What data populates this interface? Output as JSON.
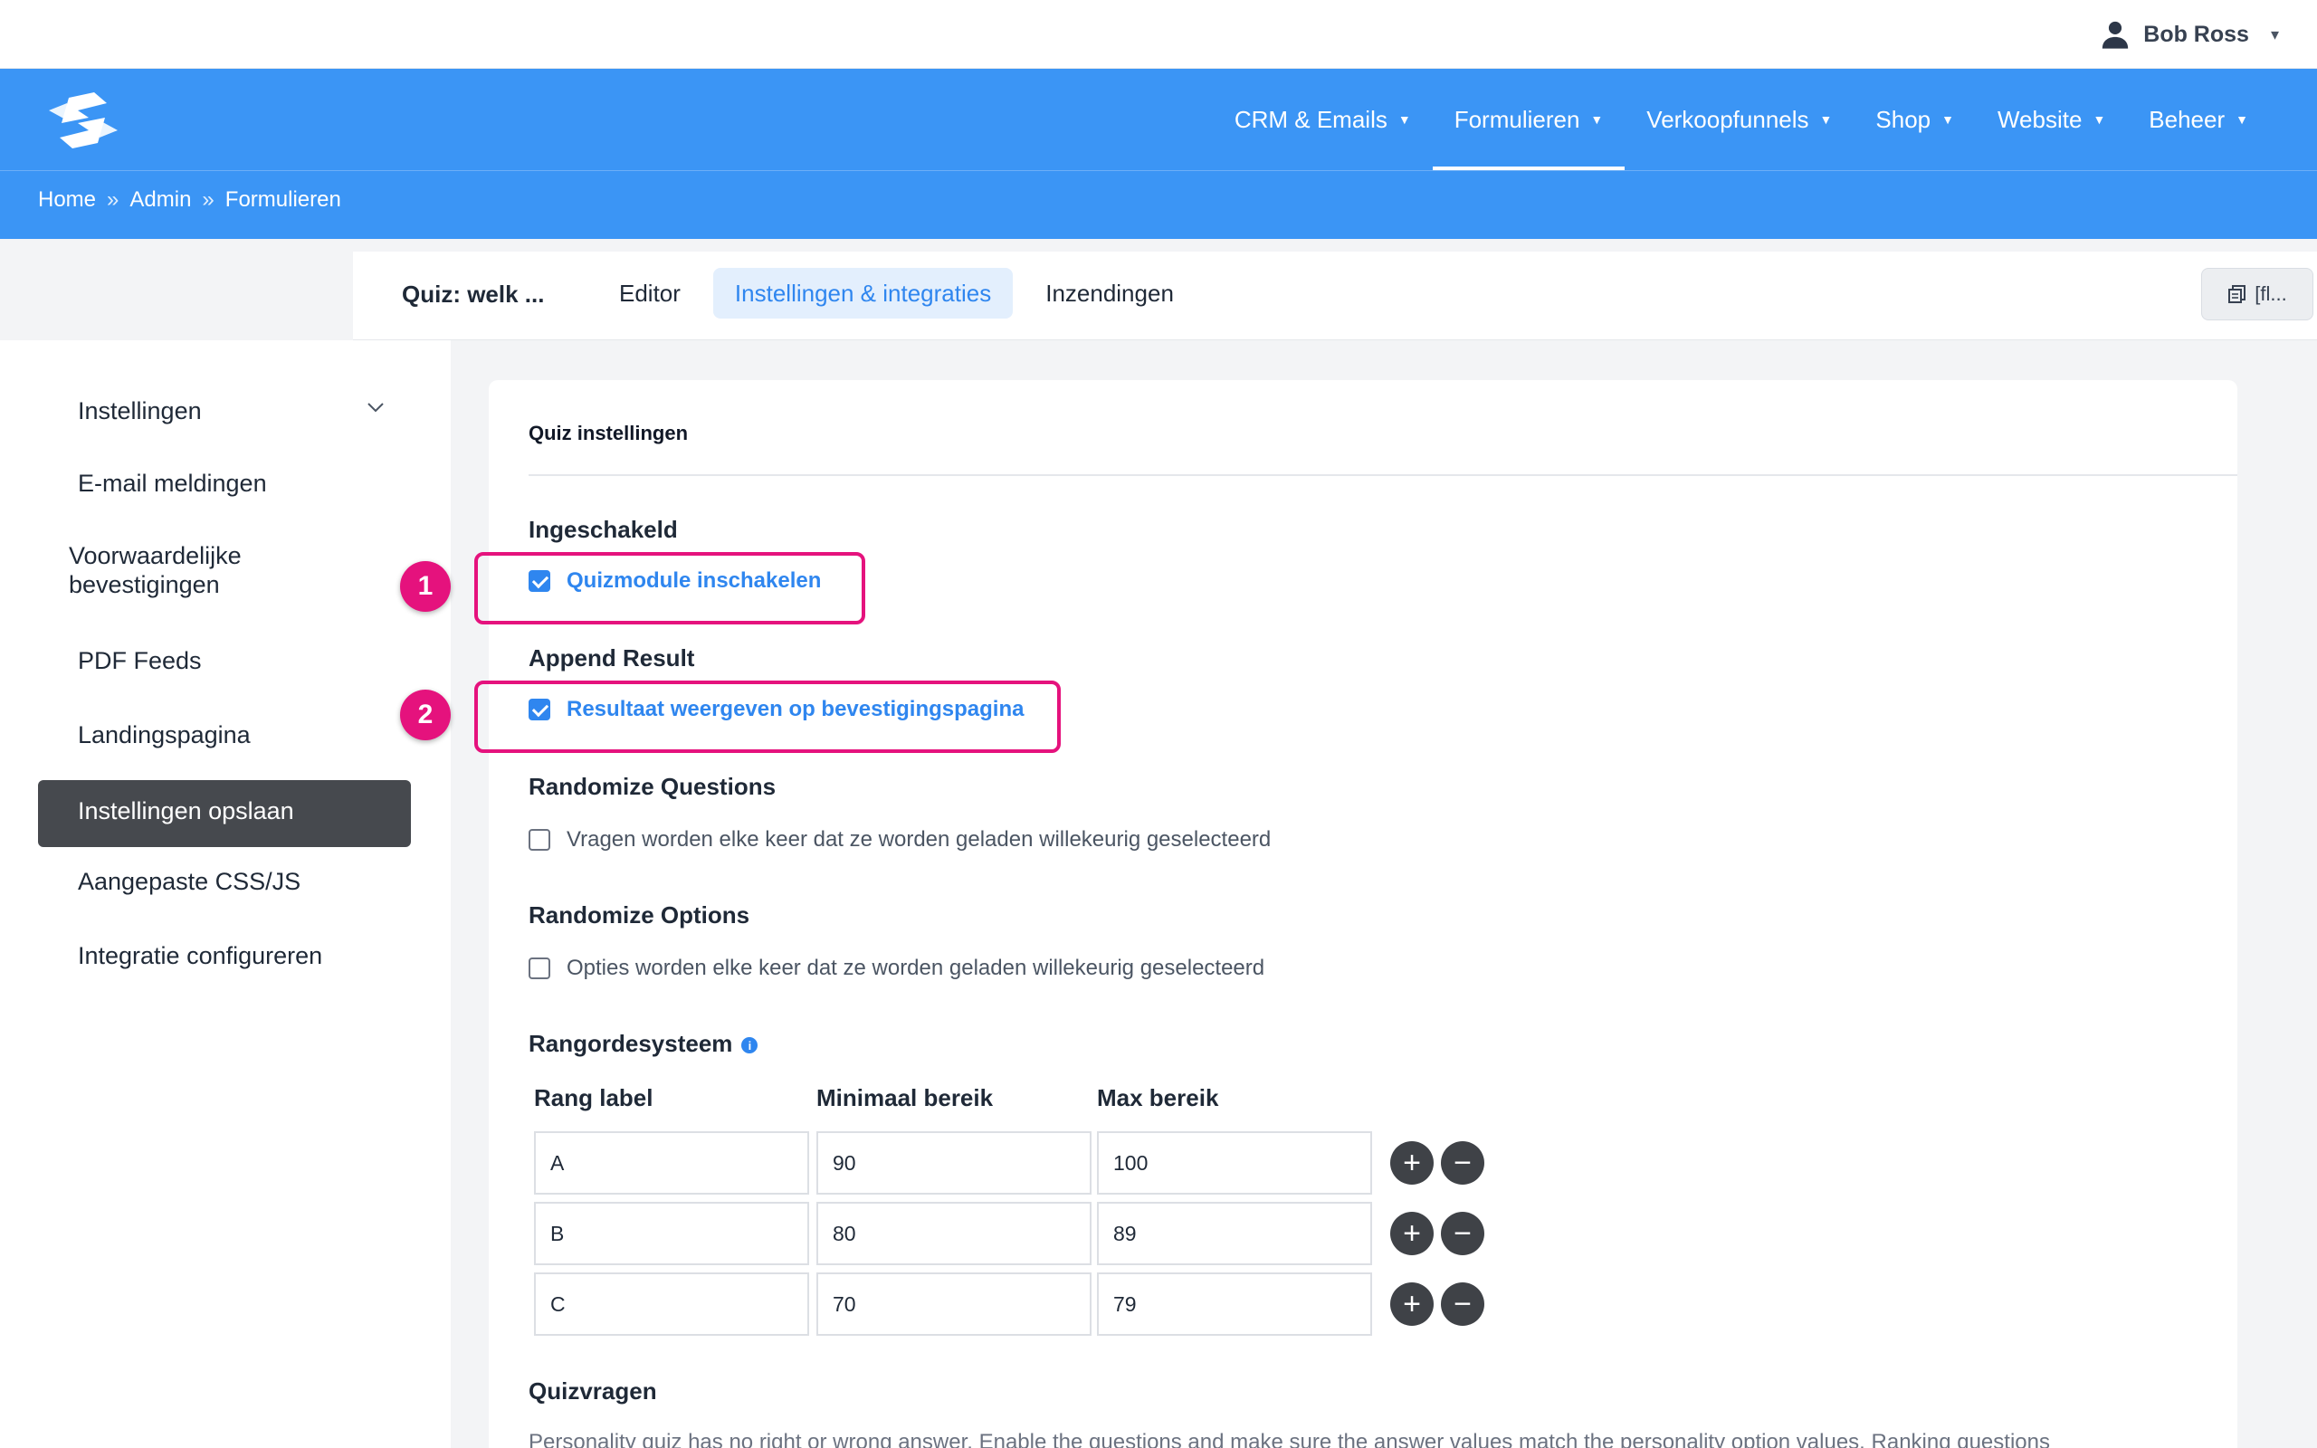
{
  "user": {
    "name": "Bob Ross",
    "caret": "▾"
  },
  "nav": {
    "items": [
      {
        "label": "CRM & Emails"
      },
      {
        "label": "Formulieren"
      },
      {
        "label": "Verkoopfunnels"
      },
      {
        "label": "Shop"
      },
      {
        "label": "Website"
      },
      {
        "label": "Beheer"
      }
    ],
    "active": "Formulieren"
  },
  "breadcrumb": {
    "items": [
      "Home",
      "Admin",
      "Formulieren"
    ],
    "separator": "»"
  },
  "subheader": {
    "form_title": "Quiz: welk ...",
    "tabs": [
      "Editor",
      "Instellingen & integraties",
      "Inzendingen"
    ],
    "active_tab": "Instellingen & integraties",
    "shortcode_label": "[fl..."
  },
  "sidebar": {
    "items": [
      {
        "label": "Instellingen"
      },
      {
        "label": "E-mail meldingen"
      },
      {
        "label": "Voorwaardelijke bevestigingen"
      },
      {
        "label": "PDF Feeds"
      },
      {
        "label": "Landingspagina"
      },
      {
        "label": "Instellingen opslaan"
      },
      {
        "label": "Aangepaste CSS/JS"
      },
      {
        "label": "Integratie configureren"
      }
    ],
    "active": "Instellingen opslaan"
  },
  "card": {
    "title": "Quiz instellingen",
    "enabled": {
      "label": "Ingeschakeld",
      "checkbox": "Quizmodule inschakelen",
      "checked": true
    },
    "append_result": {
      "label": "Append Result",
      "checkbox": "Resultaat weergeven op bevestigingspagina",
      "checked": true
    },
    "randomize_questions": {
      "label": "Randomize Questions",
      "checkbox": "Vragen worden elke keer dat ze worden geladen willekeurig geselecteerd",
      "checked": false
    },
    "randomize_options": {
      "label": "Randomize Options",
      "checkbox": "Opties worden elke keer dat ze worden geladen willekeurig geselecteerd",
      "checked": false
    },
    "ranking": {
      "label": "Rangordesysteem",
      "info_icon": "i",
      "headers": [
        "Rang label",
        "Minimaal bereik",
        "Max bereik"
      ],
      "rows": [
        {
          "rank": "A",
          "min": "90",
          "max": "100"
        },
        {
          "rank": "B",
          "min": "80",
          "max": "89"
        },
        {
          "rank": "C",
          "min": "70",
          "max": "79"
        }
      ]
    },
    "questions": {
      "label": "Quizvragen",
      "description": "Personality quiz has no right or wrong answer. Enable the questions and make sure the answer values match the personality option values. Ranking questions"
    }
  },
  "annotations": [
    {
      "number": "1"
    },
    {
      "number": "2"
    }
  ],
  "colors": {
    "brand_blue": "#3b95f5",
    "accent": "#2f86ef",
    "highlight": "#e5127d",
    "sidebar_active": "#46494e"
  },
  "icons": {
    "user": "user-icon",
    "logo": "logo-icon",
    "plus": "+",
    "minus": "−",
    "chevron": "chevron-down-icon",
    "shortcode": "copy-icon"
  }
}
